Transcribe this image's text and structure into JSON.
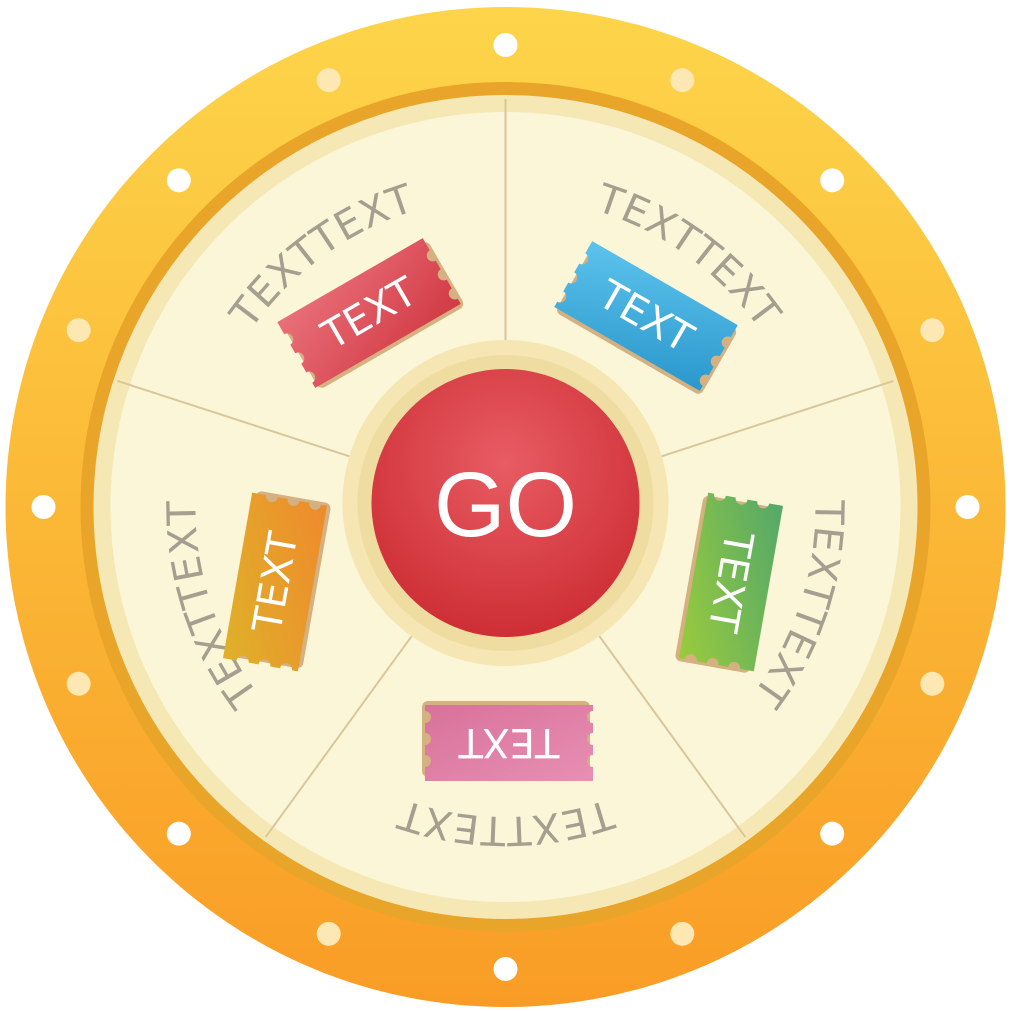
{
  "wheel": {
    "go_label": "GO",
    "segments": [
      {
        "label": "TEXTTEXT",
        "ticket_label": "TEXT",
        "ticket_color": "red"
      },
      {
        "label": "TEXTTEXT",
        "ticket_label": "TEXT",
        "ticket_color": "blue"
      },
      {
        "label": "TEXTTEXT",
        "ticket_label": "TEXT",
        "ticket_color": "green"
      },
      {
        "label": "TEXTTEXT",
        "ticket_label": "TEXT",
        "ticket_color": "pink"
      },
      {
        "label": "TEXTTEXT",
        "ticket_label": "TEXT",
        "ticket_color": "orange"
      }
    ]
  },
  "colors": {
    "rim": "#fbae2f",
    "rim_light": "#fdd54a",
    "face": "#fbf6d8",
    "face_ring": "#f6e8b5",
    "divider": "#d9c79b",
    "segment_text": "#a49f8f",
    "go_button": "#d8393e",
    "ticket_red": "#d9474f",
    "ticket_blue": "#33a6d8",
    "ticket_green": "#6dbb45",
    "ticket_pink": "#dc7ea4",
    "ticket_orange": "#e8992a"
  }
}
